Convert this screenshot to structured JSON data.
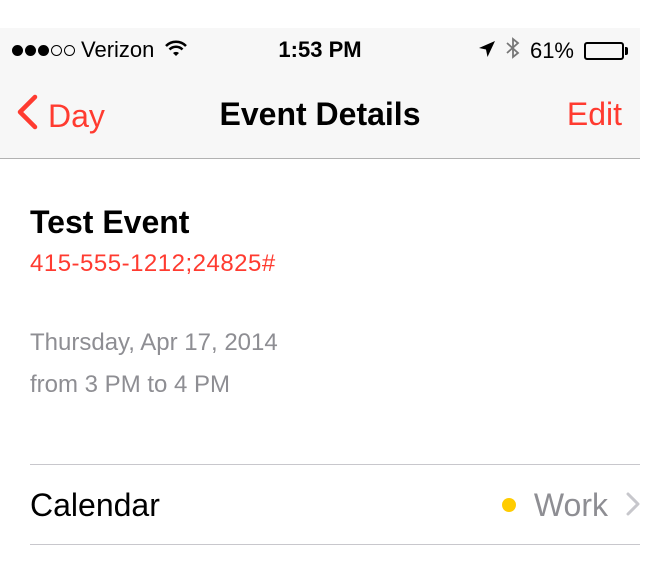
{
  "status_bar": {
    "carrier": "Verizon",
    "time": "1:53 PM",
    "battery": "61%",
    "battery_level": 0.61,
    "signal_bars": 3,
    "signal_total": 5
  },
  "nav": {
    "back_label": "Day",
    "title": "Event Details",
    "edit_label": "Edit"
  },
  "event": {
    "title": "Test Event",
    "phone": "415-555-1212;24825#",
    "date": "Thursday, Apr 17, 2014",
    "time_range": "from 3 PM to 4 PM"
  },
  "calendar": {
    "label": "Calendar",
    "value": "Work",
    "color": "#ffcc00"
  },
  "colors": {
    "accent": "#ff3b30",
    "secondary_text": "#8e8e93"
  }
}
